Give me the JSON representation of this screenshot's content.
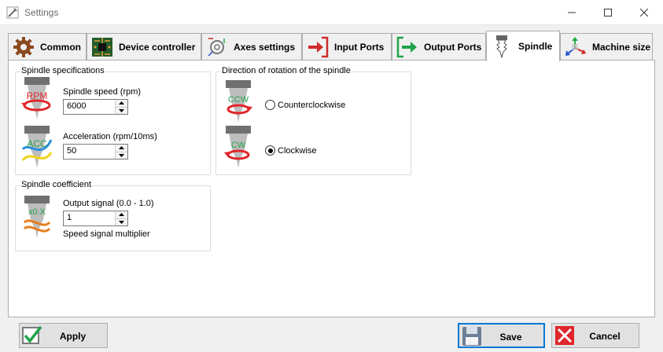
{
  "window": {
    "title": "Settings"
  },
  "tabs": [
    {
      "label": "Common",
      "icon": "gear-icon"
    },
    {
      "label": "Device controller",
      "icon": "circuit-board-icon"
    },
    {
      "label": "Axes settings",
      "icon": "axes-gear-icon"
    },
    {
      "label": "Input Ports",
      "icon": "arrow-right-in-icon"
    },
    {
      "label": "Output Ports",
      "icon": "arrow-right-out-icon"
    },
    {
      "label": "Spindle",
      "icon": "spindle-icon",
      "active": true
    },
    {
      "label": "Machine size",
      "icon": "xyz-axes-icon"
    }
  ],
  "spindle_specs": {
    "title": "Spindle specifications",
    "speed_label": "Spindle speed (rpm)",
    "speed_value": "6000",
    "speed_icon_text": "RPM",
    "accel_label": "Acceleration (rpm/10ms)",
    "accel_value": "50",
    "accel_icon_text": "ACC"
  },
  "rotation": {
    "title": "Direction of rotation of the spindle",
    "ccw_icon_text": "CCW",
    "ccw_label": "Counterclockwise",
    "cw_icon_text": "CW",
    "cw_label": "Clockwise",
    "selected": "cw"
  },
  "coefficient": {
    "title": "Spindle coefficient",
    "output_label": "Output signal (0.0 - 1.0)",
    "output_value": "1",
    "icon_text": "x0.X",
    "multiplier_label": "Speed signal multiplier"
  },
  "buttons": {
    "apply": "Apply",
    "save": "Save",
    "cancel": "Cancel"
  },
  "colors": {
    "accent": "#0078d7",
    "icon_red": "#e0262b",
    "icon_green": "#1fa34a"
  }
}
